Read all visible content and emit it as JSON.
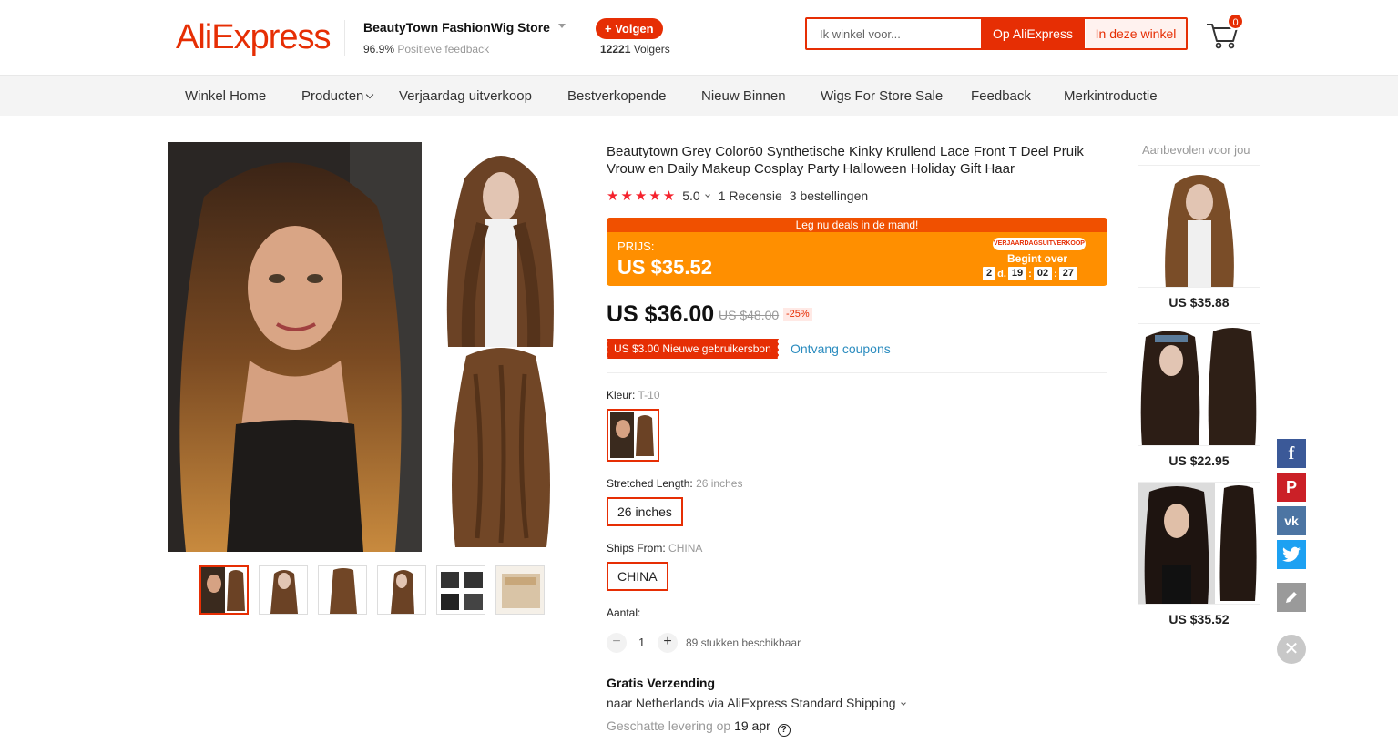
{
  "header": {
    "logo": "AliExpress",
    "store_name": "BeautyTown FashionWig Store",
    "feedback_percent": "96.9%",
    "feedback_label": "Positieve feedback",
    "follow_label": "+ Volgen",
    "followers_count": "12221",
    "followers_label": "Volgers",
    "search_placeholder": "Ik winkel voor...",
    "search_all_label": "Op AliExpress",
    "search_store_label": "In deze winkel",
    "cart_count": "0",
    "brand_color": "#e62e04"
  },
  "nav": {
    "items": [
      {
        "label": "Winkel Home"
      },
      {
        "label": "Producten"
      },
      {
        "label": "Verjaardag uitverkoop"
      },
      {
        "label": "Bestverkopende"
      },
      {
        "label": "Nieuw Binnen"
      },
      {
        "label": "Wigs For Store Sale"
      },
      {
        "label": "Feedback"
      },
      {
        "label": "Merkintroductie"
      }
    ]
  },
  "product": {
    "title": "Beautytown Grey Color60 Synthetische Kinky Krullend Lace Front T Deel Pruik Vrouw en Daily Makeup Cosplay Party Halloween Holiday Gift Haar",
    "stars": "★★★★★",
    "rating": "5.0",
    "reviews": "1 Recensie",
    "orders": "3 bestellingen",
    "deal_banner": "Leg nu deals in de mand!",
    "deal_price_label": "PRIJS:",
    "deal_price": "US $35.52",
    "deal_badge": "VERJAARDAGSUITVERKOOP",
    "deal_begin": "Begint over",
    "countdown": {
      "days": "2",
      "days_label": "d.",
      "hours": "19",
      "minutes": "02",
      "seconds": "27"
    },
    "price": "US $36.00",
    "old_price": "US $48.00",
    "discount": "-25%",
    "coupon": "US $3.00 Nieuwe gebruikersbon",
    "coupon_link": "Ontvang coupons",
    "color_label": "Kleur:",
    "color_value": "T-10",
    "length_label": "Stretched Length:",
    "length_value": "26 inches",
    "length_option": "26 inches",
    "ships_label": "Ships From:",
    "ships_value": "CHINA",
    "ships_option": "CHINA",
    "qty_label": "Aantal:",
    "qty_minus": "−",
    "qty_plus": "+",
    "qty_value": "1",
    "qty_available": "89 stukken beschikbaar",
    "shipping_title": "Gratis Verzending",
    "shipping_line": "naar Netherlands via AliExpress Standard Shipping",
    "delivery_label": "Geschatte levering op",
    "delivery_date": "19 apr"
  },
  "recommended": {
    "title": "Aanbevolen voor jou",
    "items": [
      {
        "price": "US $35.88"
      },
      {
        "price": "US $22.95"
      },
      {
        "price": "US $35.52"
      }
    ]
  },
  "social": {
    "facebook": "f",
    "pinterest": "P",
    "vk": "vk",
    "close": "✕"
  }
}
